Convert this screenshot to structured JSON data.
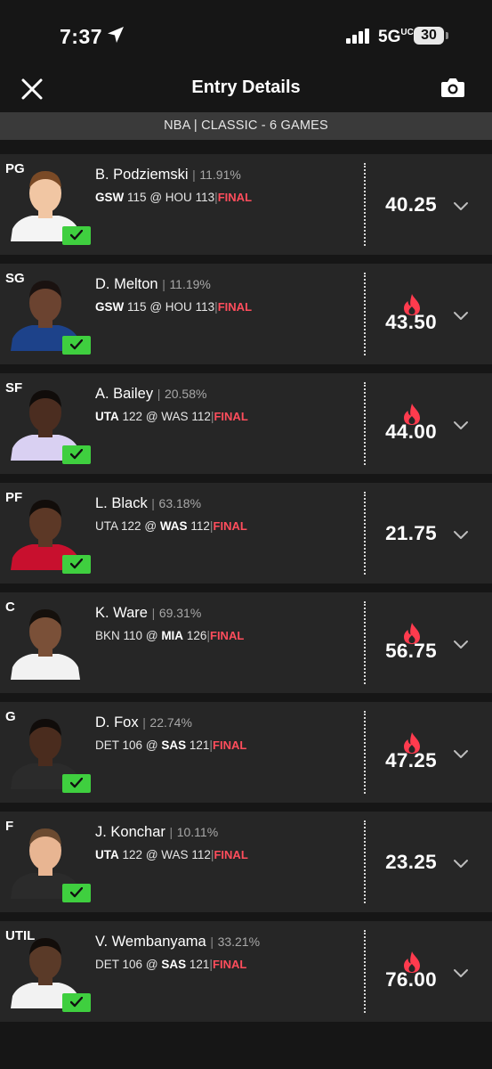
{
  "status": {
    "time": "7:37",
    "network": "5G",
    "network_sup": "UC",
    "battery": "30"
  },
  "header": {
    "title": "Entry Details"
  },
  "contest": {
    "label": "NBA | CLASSIC - 6 GAMES"
  },
  "separator": "|",
  "final_label": "FINAL",
  "colors": {
    "background": "#161616",
    "row": "#262626",
    "contest_bar": "#3a3a3a",
    "final": "#ff4d5c",
    "check": "#3fcf3f",
    "fire": "#ff3b4e"
  },
  "players": [
    {
      "position": "PG",
      "name": "B. Podziemski",
      "pct": "11.91%",
      "away": "GSW",
      "away_score": "115",
      "at": "@",
      "home": "HOU",
      "home_score": "113",
      "bold": "away",
      "points": "40.25",
      "hot": false,
      "checked": true,
      "jersey": "#f4f4f4",
      "skin": "#f1c6a3",
      "hair": "#7a4a26"
    },
    {
      "position": "SG",
      "name": "D. Melton",
      "pct": "11.19%",
      "away": "GSW",
      "away_score": "115",
      "at": "@",
      "home": "HOU",
      "home_score": "113",
      "bold": "away",
      "points": "43.50",
      "hot": true,
      "checked": true,
      "jersey": "#1d428a",
      "skin": "#6b4330",
      "hair": "#1a1210"
    },
    {
      "position": "SF",
      "name": "A. Bailey",
      "pct": "20.58%",
      "away": "UTA",
      "away_score": "122",
      "at": "@",
      "home": "WAS",
      "home_score": "112",
      "bold": "away",
      "points": "44.00",
      "hot": true,
      "checked": true,
      "jersey": "#d9d0f2",
      "skin": "#4b2d20",
      "hair": "#100c0a"
    },
    {
      "position": "PF",
      "name": "L. Black",
      "pct": "63.18%",
      "away": "UTA",
      "away_score": "122",
      "at": "@",
      "home": "WAS",
      "home_score": "112",
      "bold": "home",
      "points": "21.75",
      "hot": false,
      "checked": true,
      "jersey": "#c8102e",
      "skin": "#5c3826",
      "hair": "#120d0a"
    },
    {
      "position": "C",
      "name": "K. Ware",
      "pct": "69.31%",
      "away": "BKN",
      "away_score": "110",
      "at": "@",
      "home": "MIA",
      "home_score": "126",
      "bold": "home",
      "points": "56.75",
      "hot": true,
      "checked": false,
      "jersey": "#f2f2f2",
      "skin": "#7a5038",
      "hair": "#15100c"
    },
    {
      "position": "G",
      "name": "D. Fox",
      "pct": "22.74%",
      "away": "DET",
      "away_score": "106",
      "at": "@",
      "home": "SAS",
      "home_score": "121",
      "bold": "home",
      "points": "47.25",
      "hot": true,
      "checked": true,
      "jersey": "#2b2b2b",
      "skin": "#4a2c1e",
      "hair": "#100c0a"
    },
    {
      "position": "F",
      "name": "J. Konchar",
      "pct": "10.11%",
      "away": "UTA",
      "away_score": "122",
      "at": "@",
      "home": "WAS",
      "home_score": "112",
      "bold": "away",
      "points": "23.25",
      "hot": false,
      "checked": true,
      "jersey": "#2b2b2b",
      "skin": "#e8b592",
      "hair": "#6b4a30"
    },
    {
      "position": "UTIL",
      "name": "V. Wembanyama",
      "pct": "33.21%",
      "away": "DET",
      "away_score": "106",
      "at": "@",
      "home": "SAS",
      "home_score": "121",
      "bold": "home",
      "points": "76.00",
      "hot": true,
      "checked": true,
      "jersey": "#f2f2f2",
      "skin": "#5a3a28",
      "hair": "#120d0a"
    }
  ]
}
